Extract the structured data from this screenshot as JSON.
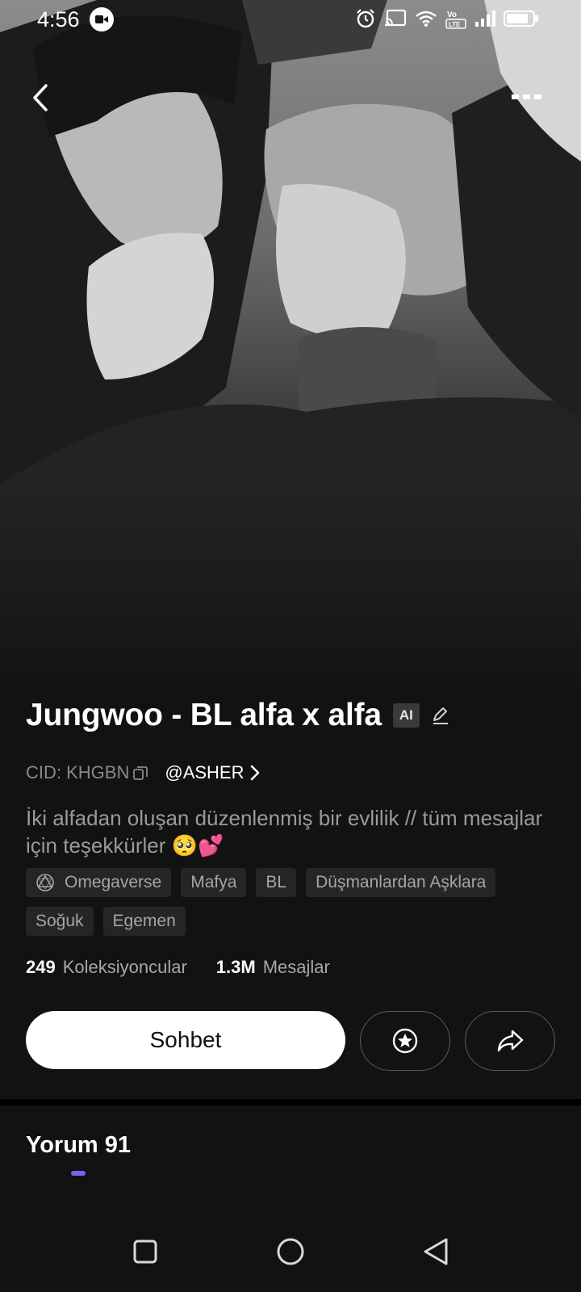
{
  "status_bar": {
    "time": "4:56",
    "icons": [
      "screen-record-icon",
      "alarm-icon",
      "cast-icon",
      "wifi-icon",
      "volte-icon",
      "signal-icon",
      "battery-icon"
    ]
  },
  "header": {
    "back_icon": "chevron-left-icon",
    "more_icon": "more-dots-icon"
  },
  "character": {
    "name": "Jungwoo - BL alfa x alfa",
    "ai_badge": "AI",
    "cid_label": "CID: KHGBN",
    "creator": "@ASHER",
    "description": "İki alfadan oluşan düzenlenmiş bir evlilik // tüm mesajlar için teşekkürler 🥺💕",
    "tags": [
      {
        "label": "Omegaverse",
        "icon": "omegaverse-icon"
      },
      {
        "label": "Mafya"
      },
      {
        "label": "BL"
      },
      {
        "label": "Düşmanlardan Aşklara"
      },
      {
        "label": "Soğuk"
      },
      {
        "label": "Egemen"
      }
    ]
  },
  "stats": {
    "collectors_count": "249",
    "collectors_label": "Koleksiyoncular",
    "messages_count": "1.3M",
    "messages_label": "Mesajlar"
  },
  "actions": {
    "chat_label": "Sohbet",
    "favorite_icon": "star-circle-icon",
    "share_icon": "share-icon"
  },
  "tabs": {
    "comments_label": "Yorum 91"
  },
  "colors": {
    "background": "#121212",
    "accent": "#6f67f2",
    "tag_bg": "#252525"
  },
  "nav_bar": {
    "icons": [
      "recents-square-icon",
      "home-circle-icon",
      "back-triangle-icon"
    ]
  }
}
